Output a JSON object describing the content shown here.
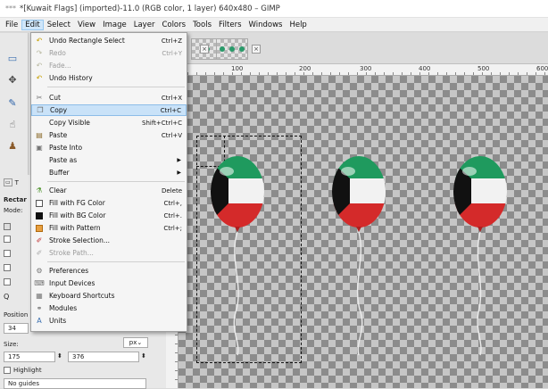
{
  "window": {
    "title": "*[Kuwait Flags] (imported)-11.0 (RGB color, 1 layer) 640x480 – GIMP",
    "title_prefix": "***"
  },
  "menubar": [
    {
      "label": "File",
      "active": false
    },
    {
      "label": "Edit",
      "active": true
    },
    {
      "label": "Select",
      "active": false
    },
    {
      "label": "View",
      "active": false
    },
    {
      "label": "Image",
      "active": false
    },
    {
      "label": "Layer",
      "active": false
    },
    {
      "label": "Colors",
      "active": false
    },
    {
      "label": "Tools",
      "active": false
    },
    {
      "label": "Filters",
      "active": false
    },
    {
      "label": "Windows",
      "active": false
    },
    {
      "label": "Help",
      "active": false
    }
  ],
  "edit_menu": [
    {
      "label": "Undo Rectangle Select",
      "shortcut": "Ctrl+Z",
      "icon": "undo-icon",
      "disabled": false
    },
    {
      "label": "Redo",
      "shortcut": "Ctrl+Y",
      "icon": "redo-icon",
      "disabled": true
    },
    {
      "label": "Fade...",
      "shortcut": "",
      "icon": "fade-icon",
      "disabled": true
    },
    {
      "label": "Undo History",
      "shortcut": "",
      "icon": "undo-history-icon",
      "disabled": false
    },
    {
      "label": "Cut",
      "shortcut": "Ctrl+X",
      "icon": "cut-icon",
      "disabled": false
    },
    {
      "label": "Copy",
      "shortcut": "Ctrl+C",
      "icon": "copy-icon",
      "disabled": false,
      "highlighted": true
    },
    {
      "label": "Copy Visible",
      "shortcut": "Shift+Ctrl+C",
      "icon": "",
      "disabled": false
    },
    {
      "label": "Paste",
      "shortcut": "Ctrl+V",
      "icon": "paste-icon",
      "disabled": false
    },
    {
      "label": "Paste Into",
      "shortcut": "",
      "icon": "paste-into-icon",
      "disabled": false
    },
    {
      "label": "Paste as",
      "shortcut": "",
      "icon": "",
      "disabled": false,
      "submenu": true
    },
    {
      "label": "Buffer",
      "shortcut": "",
      "icon": "",
      "disabled": false,
      "submenu": true
    },
    {
      "label": "Clear",
      "shortcut": "Delete",
      "icon": "clear-icon",
      "disabled": false
    },
    {
      "label": "Fill with FG Color",
      "shortcut": "Ctrl+,",
      "icon": "fg-color-icon",
      "disabled": false
    },
    {
      "label": "Fill with BG Color",
      "shortcut": "Ctrl+.",
      "icon": "bg-color-icon",
      "disabled": false
    },
    {
      "label": "Fill with Pattern",
      "shortcut": "Ctrl+;",
      "icon": "pattern-icon",
      "disabled": false
    },
    {
      "label": "Stroke Selection...",
      "shortcut": "",
      "icon": "stroke-selection-icon",
      "disabled": false
    },
    {
      "label": "Stroke Path...",
      "shortcut": "",
      "icon": "stroke-path-icon",
      "disabled": true
    },
    {
      "label": "Preferences",
      "shortcut": "",
      "icon": "preferences-icon",
      "disabled": false
    },
    {
      "label": "Input Devices",
      "shortcut": "",
      "icon": "input-devices-icon",
      "disabled": false
    },
    {
      "label": "Keyboard Shortcuts",
      "shortcut": "",
      "icon": "keyboard-icon",
      "disabled": false
    },
    {
      "label": "Modules",
      "shortcut": "",
      "icon": "modules-icon",
      "disabled": false
    },
    {
      "label": "Units",
      "shortcut": "",
      "icon": "units-icon",
      "disabled": false
    }
  ],
  "ruler": {
    "labels": [
      "100",
      "200",
      "300",
      "400",
      "500",
      "600"
    ]
  },
  "tool_options": {
    "title_partial": "T",
    "tool_partial": "Rectar",
    "mode_partial": "Mode:",
    "position_label": "Position",
    "position_value": "34",
    "size_label": "Size:",
    "size_w": "175",
    "size_h": "376",
    "unit": "px",
    "highlight_label": "Highlight",
    "guides_value": "No guides"
  },
  "colors": {
    "accent": "#cfe6fa",
    "highlight": "#c9e2f8",
    "flag_green": "#1f9a5e",
    "flag_red": "#d42a2a",
    "flag_black": "#111111"
  }
}
